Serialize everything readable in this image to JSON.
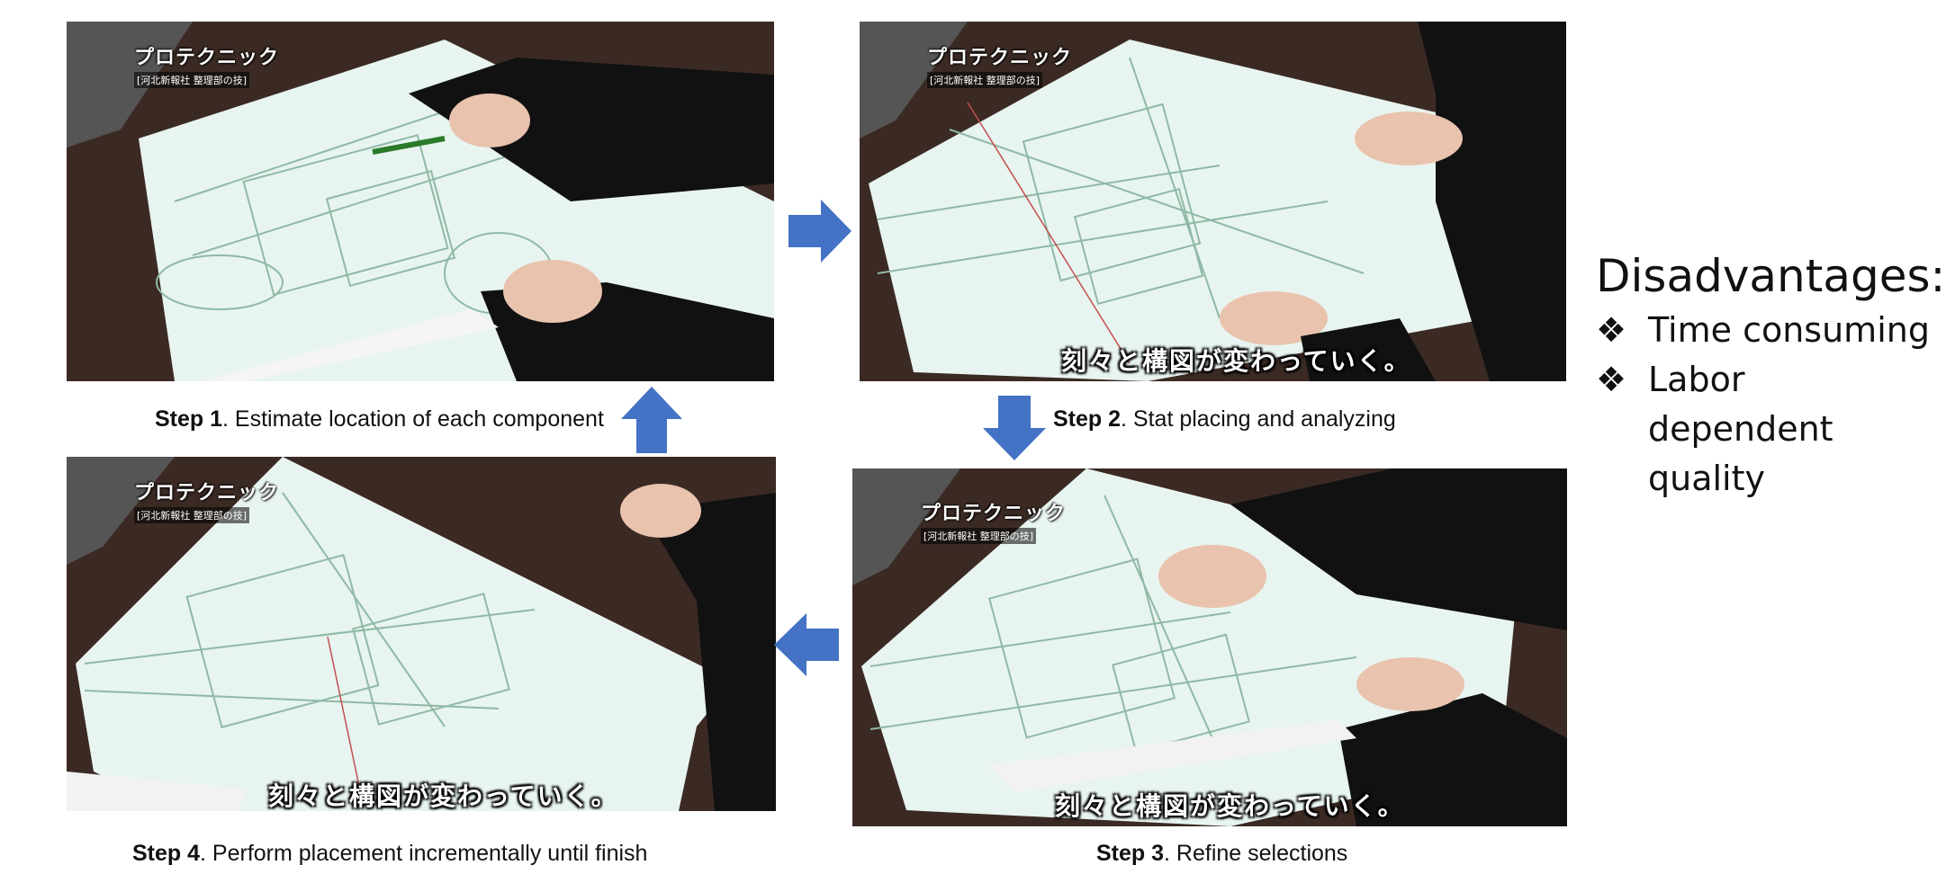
{
  "panels": [
    {
      "logo": "プロテクニック",
      "logo_sub": "[河北新報社 整理部の技]",
      "subtitle": ""
    },
    {
      "logo": "プロテクニック",
      "logo_sub": "[河北新報社 整理部の技]",
      "subtitle": "刻々と構図が変わっていく。"
    },
    {
      "logo": "プロテクニック",
      "logo_sub": "[河北新報社 整理部の技]",
      "subtitle": "刻々と構図が変わっていく。"
    },
    {
      "logo": "プロテクニック",
      "logo_sub": "[河北新報社 整理部の技]",
      "subtitle": "刻々と構図が変わっていく。"
    }
  ],
  "steps": [
    {
      "label": "Step 1",
      "text": ". Estimate  location of each component"
    },
    {
      "label": "Step 2",
      "text": ". Stat placing and analyzing"
    },
    {
      "label": "Step 3",
      "text": ". Refine selections"
    },
    {
      "label": "Step 4",
      "text": ". Perform placement incrementally until finish"
    }
  ],
  "disadvantages": {
    "title": "Disadvantages:",
    "bullet": "❖",
    "items": [
      "Time consuming",
      "Labor dependent quality"
    ]
  },
  "colors": {
    "arrow": "#4472C4",
    "desk": "#3a2a24",
    "paper": "#e6f3ee"
  }
}
